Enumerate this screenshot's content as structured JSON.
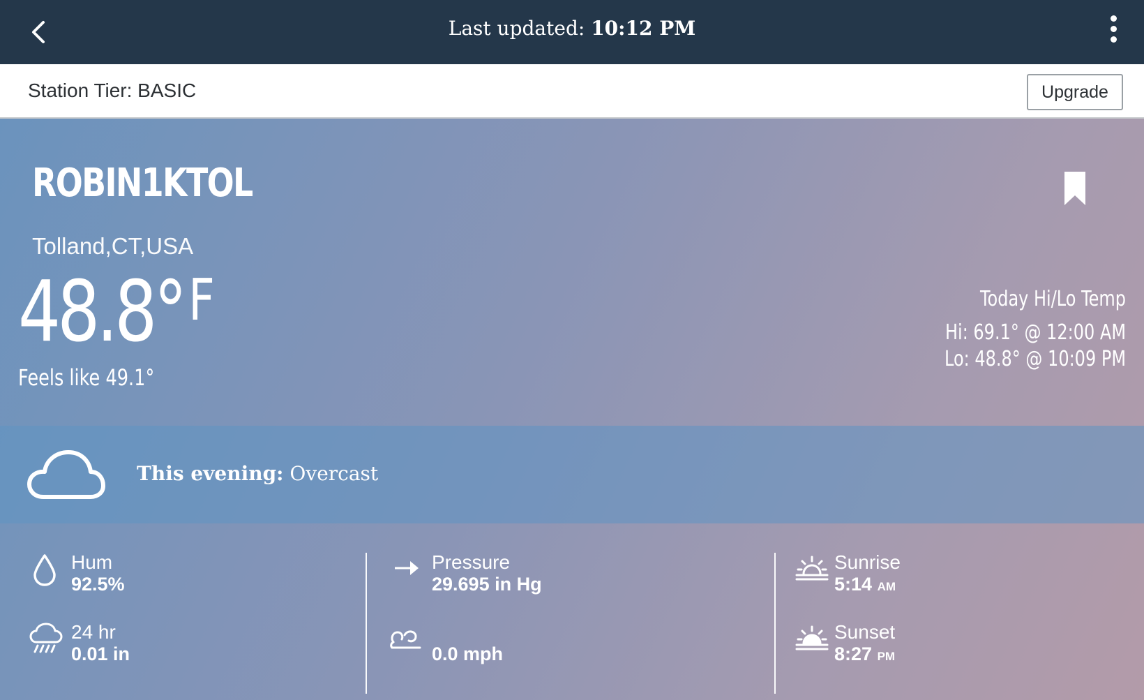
{
  "header": {
    "title_prefix": "Last updated:",
    "title_time": "10:12 PM"
  },
  "tier": {
    "label": "Station Tier: BASIC",
    "upgrade_label": "Upgrade"
  },
  "station": {
    "name": "ROBIN1KTOL",
    "location": "Tolland,CT,USA",
    "temperature": "48.8°",
    "unit": "F",
    "feels_like": "Feels like 49.1°",
    "hilo_title": "Today Hi/Lo Temp",
    "hi": "Hi: 69.1° @ 12:00 AM",
    "lo": "Lo: 48.8° @ 10:09 PM"
  },
  "forecast": {
    "period": "This evening:",
    "condition": "Overcast",
    "icon": "cloud-icon"
  },
  "stats": {
    "humidity_label": "Hum",
    "humidity_value": "92.5%",
    "rain_label": "24 hr",
    "rain_value": "0.01 in",
    "pressure_label": "Pressure",
    "pressure_value": "29.695 in Hg",
    "wind_value": "0.0 mph",
    "sunrise_label": "Sunrise",
    "sunrise_time": "5:14",
    "sunrise_ampm": "AM",
    "sunset_label": "Sunset",
    "sunset_time": "8:27",
    "sunset_ampm": "PM"
  },
  "colors": {
    "header_bg": "#24374a",
    "gradient_start": "#6b93bd",
    "gradient_end": "#b39ba9"
  }
}
